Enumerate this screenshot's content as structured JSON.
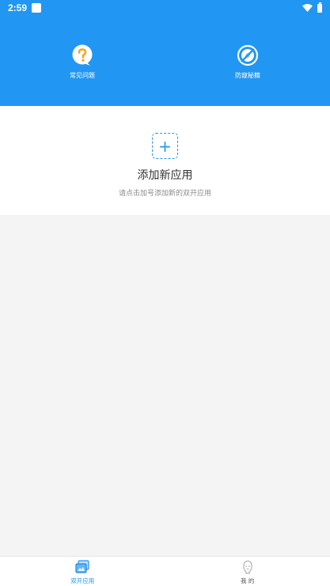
{
  "status_bar": {
    "time": "2:59"
  },
  "header": {
    "quick_actions": [
      {
        "label": "常见问题",
        "icon": "question-bubble-icon",
        "icon_color": "#f5a623"
      },
      {
        "label": "防窥秘籍",
        "icon": "compass-no-spy-icon",
        "icon_color": "#2196f3"
      }
    ]
  },
  "add_card": {
    "button_symbol": "+",
    "title": "添加新应用",
    "hint": "请点击加号添加新的双开应用"
  },
  "bottom_nav": {
    "items": [
      {
        "label": "双开应用",
        "icon": "dual-apps-icon",
        "active": true
      },
      {
        "label": "我 的",
        "icon": "profile-face-icon",
        "active": false
      }
    ]
  },
  "colors": {
    "primary": "#2196f3",
    "background": "#f4f4f4",
    "card": "#ffffff",
    "faq_accent": "#f5a623"
  }
}
